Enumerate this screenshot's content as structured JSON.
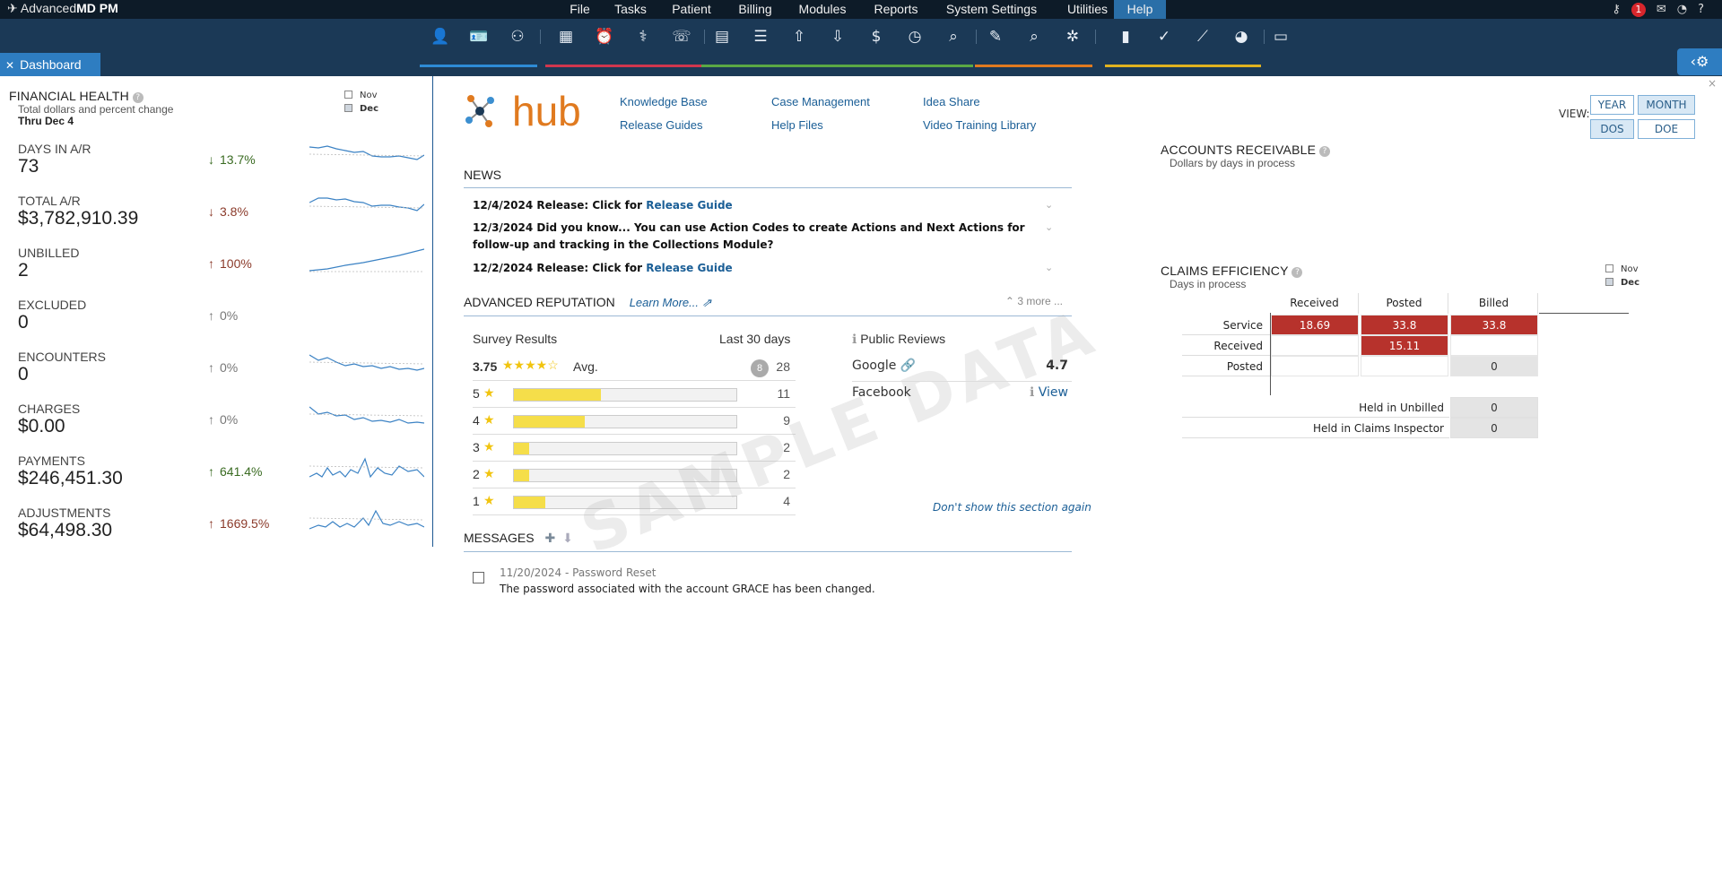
{
  "app": {
    "brand_light": "Advanced",
    "brand_bold": "MD PM"
  },
  "menu": [
    "File",
    "Tasks",
    "Patient",
    "Billing",
    "Modules",
    "Reports",
    "System Settings",
    "Utilities",
    "Help"
  ],
  "active_menu": "Help",
  "notifications": {
    "count": "1"
  },
  "tab": {
    "label": "Dashboard"
  },
  "financial_health": {
    "title": "FINANCIAL HEALTH",
    "subtitle": "Total dollars and percent change",
    "thru": "Thru Dec 4",
    "legend": [
      "Nov",
      "Dec"
    ],
    "rows": [
      {
        "label": "DAYS IN A/R",
        "value": "73",
        "change": "13.7%",
        "dir": "down",
        "tone": "good"
      },
      {
        "label": "TOTAL A/R",
        "value": "$3,782,910.39",
        "change": "3.8%",
        "dir": "down",
        "tone": "bad"
      },
      {
        "label": "UNBILLED",
        "value": "2",
        "change": "100%",
        "dir": "up",
        "tone": "bad"
      },
      {
        "label": "EXCLUDED",
        "value": "0",
        "change": "0%",
        "dir": "up",
        "tone": "neutral"
      },
      {
        "label": "ENCOUNTERS",
        "value": "0",
        "change": "0%",
        "dir": "up",
        "tone": "neutral"
      },
      {
        "label": "CHARGES",
        "value": "$0.00",
        "change": "0%",
        "dir": "up",
        "tone": "neutral"
      },
      {
        "label": "PAYMENTS",
        "value": "$246,451.30",
        "change": "641.4%",
        "dir": "up",
        "tone": "good"
      },
      {
        "label": "ADJUSTMENTS",
        "value": "$64,498.30",
        "change": "1669.5%",
        "dir": "up",
        "tone": "bad"
      }
    ]
  },
  "hub": {
    "logo_text": "hub",
    "links": [
      "Knowledge Base",
      "Case Management",
      "Idea Share",
      "Release Guides",
      "Help Files",
      "Video Training Library"
    ]
  },
  "news": {
    "title": "NEWS",
    "items": [
      {
        "text": "12/4/2024 Release: Click for ",
        "link": "Release Guide"
      },
      {
        "text": "12/3/2024 Did you know... You can use Action Codes to create Actions and Next Actions for follow-up and tracking in the Collections Module?",
        "link": ""
      },
      {
        "text": "12/2/2024 Release: Click for ",
        "link": "Release Guide"
      }
    ],
    "more": "3 more ..."
  },
  "reputation": {
    "title": "ADVANCED REPUTATION",
    "learn_more": "Learn More...",
    "survey_title": "Survey Results",
    "period": "Last 30 days",
    "avg": "3.75",
    "avg_label": "Avg.",
    "badge": "8",
    "total": "28",
    "ratings": [
      {
        "stars": "5",
        "count": "11",
        "share": 0.39
      },
      {
        "stars": "4",
        "count": "9",
        "share": 0.32
      },
      {
        "stars": "3",
        "count": "2",
        "share": 0.07
      },
      {
        "stars": "2",
        "count": "2",
        "share": 0.07
      },
      {
        "stars": "1",
        "count": "4",
        "share": 0.14
      }
    ],
    "public_title": "Public Reviews",
    "google_label": "Google",
    "google_score": "4.7",
    "facebook_label": "Facebook",
    "facebook_link": "View",
    "dont_show": "Don't show this section again"
  },
  "watermark": "SAMPLE DATA",
  "messages": {
    "title": "MESSAGES",
    "items": [
      {
        "date": "11/20/2024 - Password Reset",
        "body": "The password associated with the account GRACE has been changed."
      }
    ]
  },
  "view": {
    "label": "VIEW:",
    "options": [
      "YEAR",
      "MONTH",
      "DOS",
      "DOE"
    ],
    "selected": [
      "MONTH"
    ]
  },
  "accounts_receivable": {
    "title": "ACCOUNTS RECEIVABLE",
    "subtitle": "Dollars by days in process"
  },
  "claims": {
    "title": "CLAIMS EFFICIENCY",
    "subtitle": "Days in process",
    "legend": [
      "Nov",
      "Dec"
    ],
    "cols": [
      "Received",
      "Posted",
      "Billed"
    ],
    "rows": [
      {
        "label": "Service",
        "cells": [
          "18.69",
          "33.8",
          "33.8"
        ]
      },
      {
        "label": "Received",
        "cells": [
          "",
          "15.11",
          ""
        ]
      },
      {
        "label": "Posted",
        "cells": [
          "",
          "",
          "0"
        ]
      }
    ],
    "held": [
      {
        "label": "Held in Unbilled",
        "value": "0"
      },
      {
        "label": "Held in Claims Inspector",
        "value": "0"
      }
    ]
  },
  "colors": {
    "accent": "#2e7dc1",
    "header": "#0d1b28",
    "toolbar": "#1b3956",
    "red_cell": "#b7322c"
  }
}
